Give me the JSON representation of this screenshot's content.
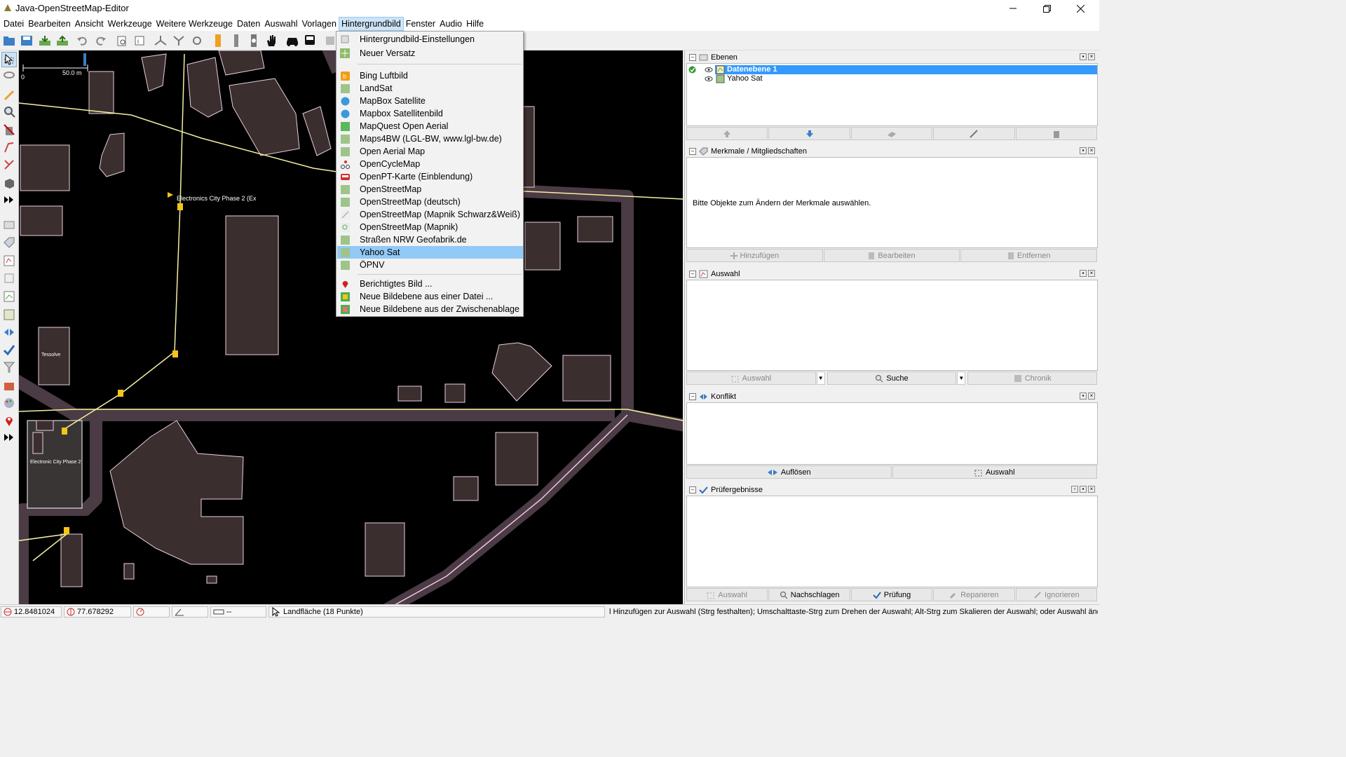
{
  "window": {
    "title": "Java-OpenStreetMap-Editor"
  },
  "menubar": [
    "Datei",
    "Bearbeiten",
    "Ansicht",
    "Werkzeuge",
    "Weitere Werkzeuge",
    "Daten",
    "Auswahl",
    "Vorlagen",
    "Hintergrundbild",
    "Fenster",
    "Audio",
    "Hilfe"
  ],
  "open_menu": "Hintergrundbild",
  "dropdown": {
    "group1": [
      "Hintergrundbild-Einstellungen",
      "Neuer Versatz"
    ],
    "group2": [
      "Bing Luftbild",
      "LandSat",
      "MapBox Satellite",
      "Mapbox Satellitenbild",
      "MapQuest Open Aerial",
      "Maps4BW (LGL-BW, www.lgl-bw.de)",
      "Open Aerial Map",
      "OpenCycleMap",
      "OpenPT-Karte (Einblendung)",
      "OpenStreetMap",
      "OpenStreetMap (deutsch)",
      "OpenStreetMap (Mapnik Schwarz&Weiß)",
      "OpenStreetMap (Mapnik)",
      "Straßen NRW Geofabrik.de",
      "Yahoo Sat",
      "ÖPNV"
    ],
    "group3": [
      "Berichtigtes Bild ...",
      "Neue Bildebene aus einer Datei ...",
      "Neue Bildebene aus der Zwischenablage"
    ],
    "selected": "Yahoo Sat"
  },
  "map": {
    "scale_label": "50.0 m",
    "scale_zero": "0",
    "labels": [
      "Electronics City Phase 2 (Ex",
      "Tessolve",
      "Electronic City Phase 2"
    ]
  },
  "panels": {
    "layers": {
      "title": "Ebenen",
      "items": [
        {
          "name": "Datenebene 1",
          "active": true
        },
        {
          "name": "Yahoo Sat",
          "active": false
        }
      ]
    },
    "tags": {
      "title": "Merkmale / Mitgliedschaften",
      "hint": "Bitte Objekte zum Ändern der Merkmale auswählen.",
      "buttons": [
        "Hinzufügen",
        "Bearbeiten",
        "Entfernen"
      ]
    },
    "selection": {
      "title": "Auswahl",
      "buttons": [
        "Auswahl",
        "Suche",
        "Chronik"
      ]
    },
    "conflict": {
      "title": "Konflikt",
      "buttons": [
        "Auflösen",
        "Auswahl"
      ]
    },
    "validator": {
      "title": "Prüfergebnisse",
      "buttons": [
        "Auswahl",
        "Nachschlagen",
        "Prüfung",
        "Reparieren",
        "Ignorieren"
      ]
    }
  },
  "status": {
    "lat": "12.8481024",
    "lon": "77.678292",
    "heading": "",
    "angle": "",
    "distance": "--",
    "feature": "Landfläche (18 Punkte)",
    "help": "l Hinzufügen zur Auswahl (Strg festhalten); Umschalttaste-Strg zum Drehen der Auswahl; Alt-Strg zum Skalieren der Auswahl; oder Auswahl ändern"
  },
  "colors": {
    "menu_highlight": "#91c9f7",
    "layer_selected": "#3399ff",
    "map_background": "#000000",
    "building_fill": "#3b2e2e",
    "way_yellow": "#f5f0a0",
    "road_casing": "#4a3b44",
    "road_center": "#f4c6e8"
  }
}
